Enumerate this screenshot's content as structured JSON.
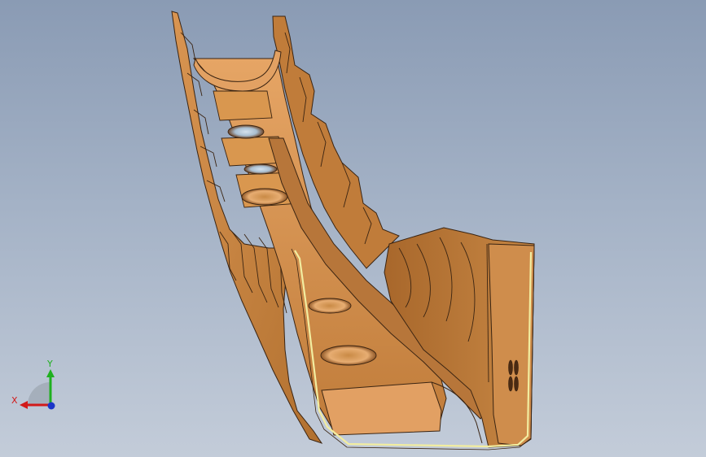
{
  "viewport": {
    "background_top": "#8a9bb4",
    "background_bottom": "#c3ccd9",
    "model": {
      "part_color": "#c98a45",
      "part_light": "#e6a565",
      "part_dark": "#8e5626",
      "edge_color": "#3a2412",
      "flange_highlight": "#f2eda0",
      "hole_tint": "#a9bed0"
    }
  },
  "triad": {
    "y_label": "Y",
    "x_label": "X",
    "y_color": "#1fb01f",
    "x_color": "#d21a1a",
    "z_color": "#1a35c8"
  }
}
